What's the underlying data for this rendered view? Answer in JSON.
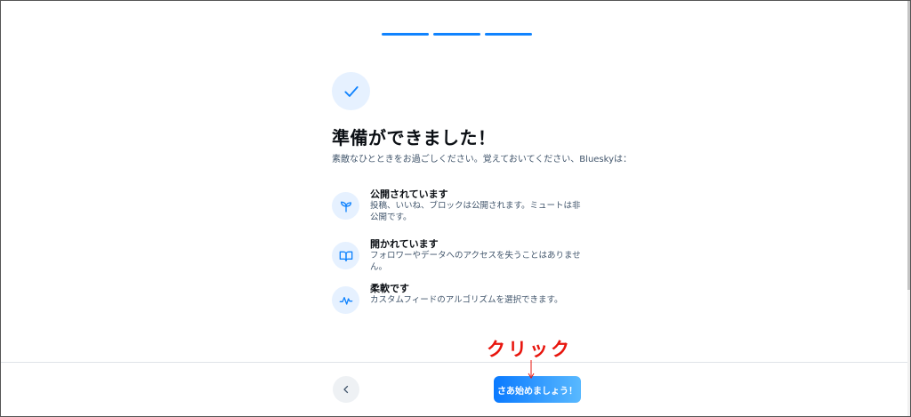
{
  "progress": {
    "segments": 3
  },
  "header": {
    "title": "準備ができました！",
    "subtitle": "素敵なひとときをお過ごしください。覚えておいてください、Blueskyは："
  },
  "features": [
    {
      "title": "公開されています",
      "desc": "投稿、いいね、ブロックは公開されます。ミュートは非公開です。",
      "icon": "sprout-icon"
    },
    {
      "title": "開かれています",
      "desc": "フォロワーやデータへのアクセスを失うことはありません。",
      "icon": "book-icon"
    },
    {
      "title": "柔軟です",
      "desc": "カスタムフィードのアルゴリズムを選択できます。",
      "icon": "pulse-icon"
    }
  ],
  "footer": {
    "start_label": "さあ始めましょう！",
    "back_icon": "chevron-left-icon"
  },
  "annotation": {
    "text": "クリック",
    "color": "#e8150d"
  },
  "colors": {
    "accent": "#1083fe",
    "icon_bg": "#e6f1ff"
  }
}
